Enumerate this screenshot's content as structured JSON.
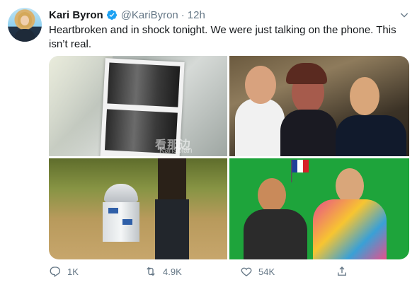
{
  "author": {
    "name": "Kari Byron",
    "handle": "@KariByron",
    "separator": "·",
    "time": "12h"
  },
  "tweet": {
    "text": "Heartbroken and in shock tonight. We were just talking on the phone. This isn’t real."
  },
  "media": {
    "watermark_main": "看那边",
    "watermark_sub": "Kanabian",
    "photos": [
      "photo-booth-strip",
      "group-photo",
      "r2d2-forest",
      "green-screen-flag"
    ]
  },
  "actions": {
    "reply_count": "1K",
    "retweet_count": "4.9K",
    "like_count": "54K"
  },
  "icons": {
    "verified": "verified-badge-icon",
    "caret": "chevron-down-icon",
    "reply": "reply-icon",
    "retweet": "retweet-icon",
    "like": "heart-icon",
    "share": "share-icon"
  },
  "colors": {
    "text": "#14171a",
    "secondary": "#657786",
    "verified": "#1da1f2",
    "green_screen": "#1ea43b"
  }
}
